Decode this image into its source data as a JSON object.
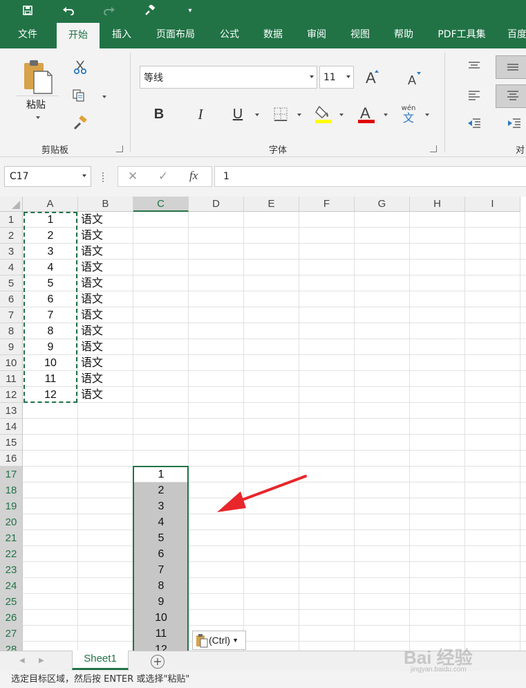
{
  "app": {
    "accent": "#217346"
  },
  "tabs": [
    {
      "label": "文件"
    },
    {
      "label": "开始"
    },
    {
      "label": "插入"
    },
    {
      "label": "页面布局"
    },
    {
      "label": "公式"
    },
    {
      "label": "数据"
    },
    {
      "label": "审阅"
    },
    {
      "label": "视图"
    },
    {
      "label": "帮助"
    },
    {
      "label": "PDF工具集"
    },
    {
      "label": "百度"
    }
  ],
  "ribbon": {
    "paste_label": "粘贴",
    "clipboard_group": "剪贴板",
    "font_group": "字体",
    "align_group_partial": "对",
    "font_name": "等线",
    "font_size": "11",
    "bold": "B",
    "italic": "I",
    "underline": "U",
    "phonetic_top": "wén",
    "phonetic_bottom": "文",
    "highlight_color": "#ffff00",
    "font_color": "#e00000"
  },
  "formula_bar": {
    "name_box": "C17",
    "cancel": "✕",
    "enter": "✓",
    "fx": "fx",
    "value": "1"
  },
  "columns": [
    "A",
    "B",
    "C",
    "D",
    "E",
    "F",
    "G",
    "H",
    "I"
  ],
  "rows": [
    "1",
    "2",
    "3",
    "4",
    "5",
    "6",
    "7",
    "8",
    "9",
    "10",
    "11",
    "12",
    "13",
    "14",
    "15",
    "16",
    "17",
    "18",
    "19",
    "20",
    "21",
    "22",
    "23",
    "24",
    "25",
    "26",
    "27",
    "28"
  ],
  "col_a": [
    "1",
    "2",
    "3",
    "4",
    "5",
    "6",
    "7",
    "8",
    "9",
    "10",
    "11",
    "12"
  ],
  "col_b": [
    "语文",
    "语文",
    "语文",
    "语文",
    "语文",
    "语文",
    "语文",
    "语文",
    "语文",
    "语文",
    "语文",
    "语文"
  ],
  "col_c": [
    "1",
    "2",
    "3",
    "4",
    "5",
    "6",
    "7",
    "8",
    "9",
    "10",
    "11",
    "12"
  ],
  "paste_options": {
    "label": "(Ctrl)"
  },
  "sheets": [
    {
      "label": "Sheet1"
    }
  ],
  "status": {
    "text": "选定目标区域，然后按 ENTER 或选择\"粘贴\""
  },
  "watermark": {
    "main": "Bai 经验",
    "sub": "jingyan.baidu.com"
  }
}
